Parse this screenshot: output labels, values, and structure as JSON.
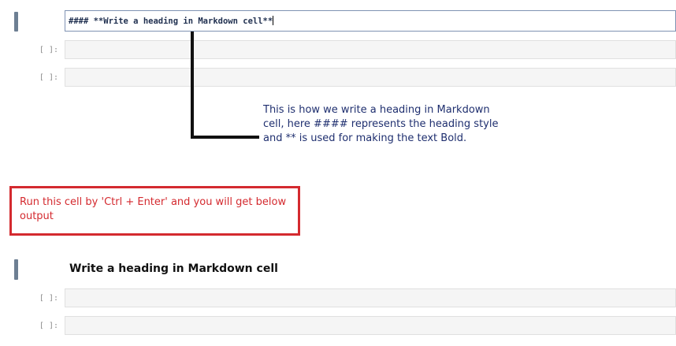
{
  "markdown_editor": {
    "source_text": "#### **Write a heading in Markdown cell**"
  },
  "empty_cells": {
    "prompt": "[ ]:"
  },
  "annotation": {
    "text": "This is how we write a heading in Markdown cell, here #### represents the heading style and ** is used for making the text Bold."
  },
  "instruction_box": {
    "text": "Run this cell by 'Ctrl + Enter' and you will get below output"
  },
  "rendered_output": {
    "heading": "Write a heading in Markdown cell"
  },
  "colors": {
    "cell_marker": "#6d7f93",
    "instruction_red": "#d42a2f",
    "annotation_text": "#1f2f6f"
  }
}
